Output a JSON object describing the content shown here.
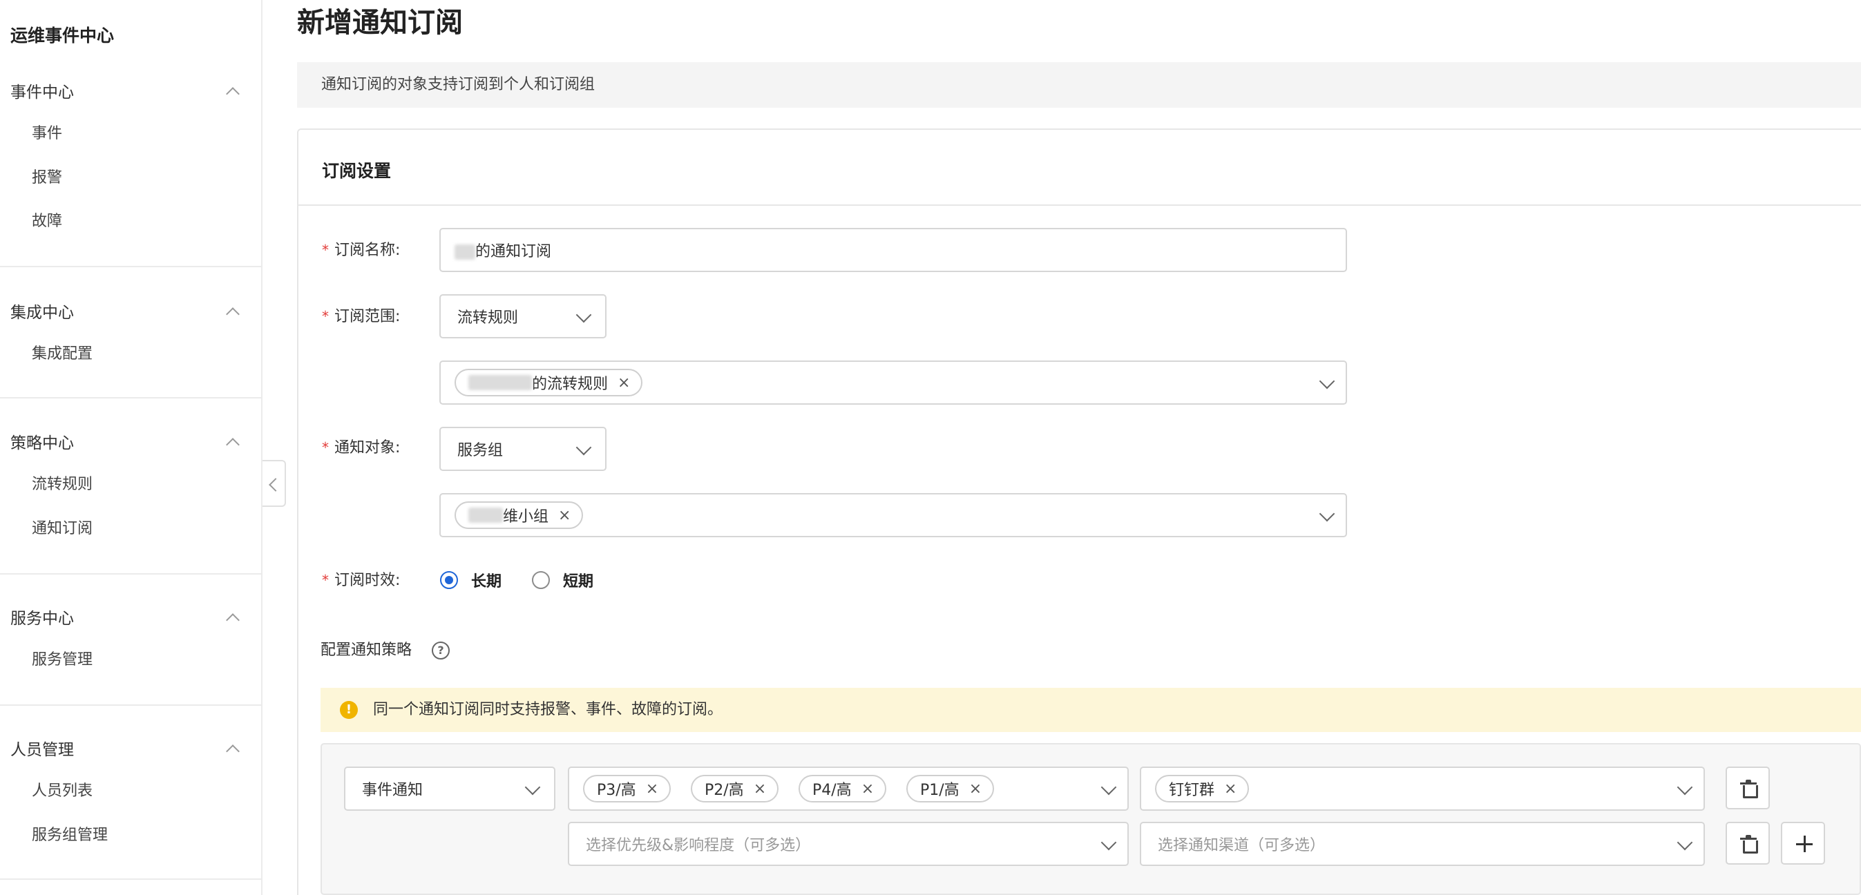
{
  "sidebar": {
    "app_title": "运维事件中心",
    "groups": [
      {
        "label": "事件中心",
        "items": [
          "事件",
          "报警",
          "故障"
        ]
      },
      {
        "label": "集成中心",
        "items": [
          "集成配置"
        ]
      },
      {
        "label": "策略中心",
        "items": [
          "流转规则",
          "通知订阅"
        ]
      },
      {
        "label": "服务中心",
        "items": [
          "服务管理"
        ]
      },
      {
        "label": "人员管理",
        "items": [
          "人员列表",
          "服务组管理"
        ]
      }
    ]
  },
  "page": {
    "title": "新增通知订阅",
    "notice": "通知订阅的对象支持订阅到个人和订阅组"
  },
  "form": {
    "section_title": "订阅设置",
    "name": {
      "label": "订阅名称:",
      "value": "的通知订阅"
    },
    "scope": {
      "label": "订阅范围:",
      "select_value": "流转规则",
      "tag": "的流转规则"
    },
    "target": {
      "label": "通知对象:",
      "select_value": "服务组",
      "tag": "维小组"
    },
    "validity": {
      "label": "订阅时效:",
      "options": [
        "长期",
        "短期"
      ],
      "selected": "长期"
    },
    "policy_label": "配置通知策略",
    "policy_help_icon": "?",
    "warning_icon": "!",
    "warning": "同一个通知订阅同时支持报警、事件、故障的订阅。",
    "policy_rows": {
      "type": "事件通知",
      "priorities": [
        "P3/高",
        "P2/高",
        "P4/高",
        "P1/高"
      ],
      "channels": [
        "钉钉群"
      ],
      "priority_placeholder": "选择优先级&影响程度（可多选）",
      "channel_placeholder": "选择通知渠道（可多选）"
    },
    "tag_close": "×"
  }
}
